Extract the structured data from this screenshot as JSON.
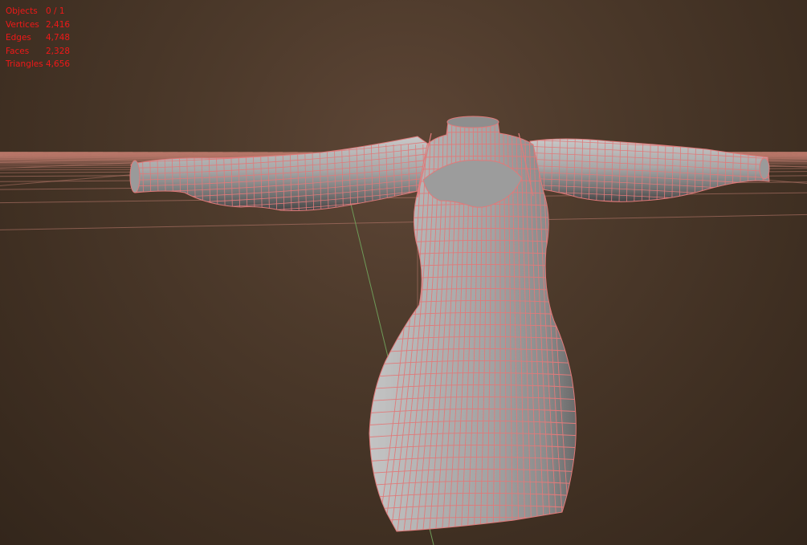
{
  "overlay_stats": [
    {
      "label": "Objects",
      "value": "0 / 1"
    },
    {
      "label": "Vertices",
      "value": "2,416"
    },
    {
      "label": "Edges",
      "value": "4,748"
    },
    {
      "label": "Faces",
      "value": "2,328"
    },
    {
      "label": "Triangles",
      "value": "4,656"
    }
  ],
  "colors": {
    "stats_text": "#f01818",
    "grid_line": "#b8786a",
    "y_axis": "#6e9a58",
    "mesh_fill": "#a6a6a6",
    "wireframe": "#e07a7a",
    "background": "#4d3a2b"
  },
  "model": {
    "shape": "long-sleeve-dress-mesh",
    "display": "solid-with-wireframe"
  }
}
